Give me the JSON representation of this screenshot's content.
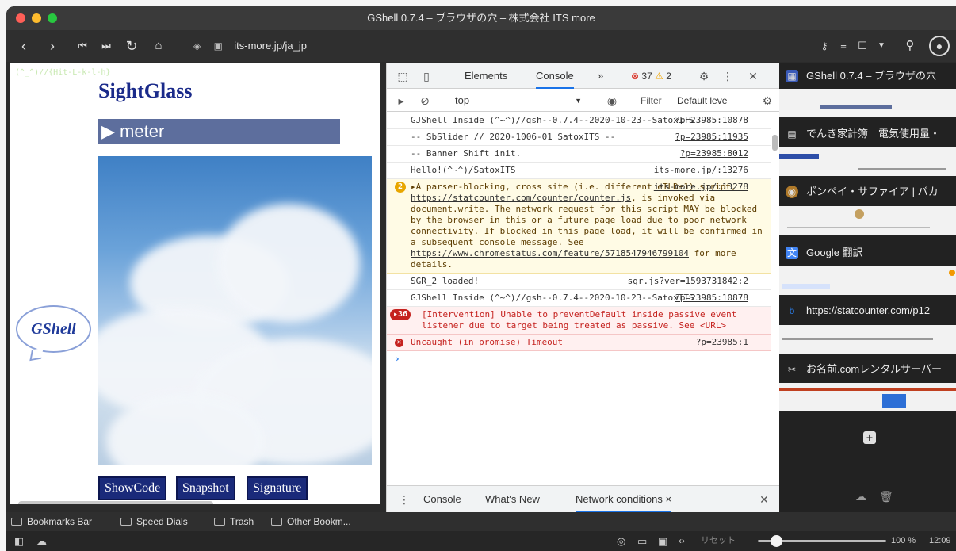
{
  "window": {
    "title": "GShell 0.7.4 – ブラウザの穴 – 株式会社 ITS more"
  },
  "nav": {
    "url": "its-more.jp/ja_jp",
    "buttons": [
      "back",
      "forward",
      "first",
      "last",
      "reload",
      "home"
    ]
  },
  "page": {
    "ascii_art": "(^_^)//{Hit-L-k-l-h}",
    "title": "SightGlass",
    "meter_label": "▶ meter",
    "gshell_logo": "GShell",
    "buttons": [
      "ShowCode",
      "Snapshot",
      "Signature"
    ]
  },
  "devtools": {
    "tabs": {
      "elements": "Elements",
      "console": "Console",
      "more": "»"
    },
    "error_count": "37",
    "warning_count": "2",
    "context": "top",
    "filter_placeholder": "Filter",
    "levels": "Default leve",
    "messages": [
      {
        "kind": "log",
        "text": "GJShell Inside (^~^)//gsh--0.7.4--2020-10-23--SatoxITS",
        "src": "?p=23985:10878"
      },
      {
        "kind": "log",
        "text": "-- SbSlider // 2020-1006-01 SatoxITS --",
        "src": "?p=23985:11935"
      },
      {
        "kind": "log",
        "text": "-- Banner Shift init.",
        "src": "?p=23985:8012"
      },
      {
        "kind": "log",
        "text": "Hello!(^~^)/SatoxITS",
        "src": "its-more.jp/:13276"
      },
      {
        "kind": "warn",
        "count": "2",
        "text_a": "▸A parser-blocking, cross site (i.e. different eTLD+1) script, ",
        "link_a": "https://statcounter.com/counter/counter.js",
        "text_b": ", is invoked via document.write. The network request for this script MAY be blocked by the browser in this or a future page load due to poor network connectivity. If blocked in this page load, it will be confirmed in a subsequent console message. See ",
        "link_b": "https://www.chromestatus.com/feature/5718547946799104",
        "text_c": " for more details.",
        "src": "its-more.jp/:13278"
      },
      {
        "kind": "log",
        "text": "SGR_2 loaded!",
        "src": "sgr.js?ver=1593731842:2"
      },
      {
        "kind": "log",
        "text": "GJShell Inside (^~^)//gsh--0.7.4--2020-10-23--SatoxITS",
        "src": "?p=23985:10878"
      },
      {
        "kind": "error",
        "count": "▸36",
        "text": "[Intervention] Unable to preventDefault inside passive event listener due to target being treated as passive. See <URL>"
      },
      {
        "kind": "error",
        "text": "Uncaught (in promise) Timeout",
        "src": "?p=23985:1"
      }
    ],
    "prompt": "›",
    "drawer_tabs": {
      "console": "Console",
      "whats_new": "What's New",
      "network": "Network conditions",
      "close": "×"
    }
  },
  "sidepanel": {
    "items": [
      {
        "title": "GShell 0.7.4 – ブラウザの穴"
      },
      {
        "title": "でんき家計簿　電気使用量・"
      },
      {
        "title": "ポンペイ・サファイア | バカ"
      },
      {
        "title": "Google 翻訳"
      },
      {
        "title": "https://statcounter.com/p12"
      },
      {
        "title": "お名前.comレンタルサーバー"
      }
    ]
  },
  "bookmarks": [
    "Bookmarks Bar",
    "Speed Dials",
    "Trash",
    "Other Bookm..."
  ],
  "status": {
    "reset": "リセット",
    "zoom": "100 %",
    "time": "12:09"
  }
}
